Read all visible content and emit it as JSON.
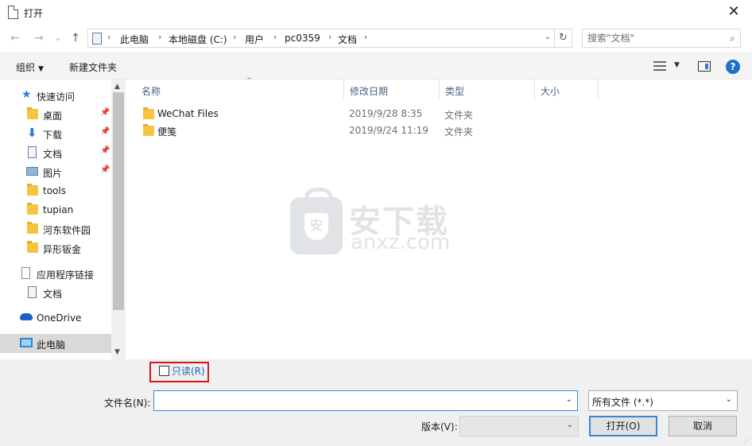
{
  "window": {
    "title": "打开",
    "close_glyph": "✕"
  },
  "nav": {
    "back_glyph": "←",
    "forward_glyph": "→",
    "recent_glyph": "⌄",
    "up_glyph": "↑",
    "breadcrumb": [
      "此电脑",
      "本地磁盘 (C:)",
      "用户",
      "pc0359",
      "文档"
    ],
    "sep": "›",
    "refresh_glyph": "↻",
    "search_placeholder": "搜索\"文档\"",
    "search_glyph": "⌕"
  },
  "toolbar": {
    "organize": "组织",
    "new_folder": "新建文件夹",
    "caret": "▼",
    "help": "?"
  },
  "sidebar": {
    "items": [
      {
        "label": "快速访问"
      },
      {
        "label": "桌面"
      },
      {
        "label": "下载"
      },
      {
        "label": "文档"
      },
      {
        "label": "图片"
      },
      {
        "label": "tools"
      },
      {
        "label": "tupian"
      },
      {
        "label": "河东软件园"
      },
      {
        "label": "异形钣金"
      },
      {
        "label": "应用程序链接"
      },
      {
        "label": "文档"
      },
      {
        "label": "OneDrive"
      },
      {
        "label": "此电脑"
      }
    ],
    "pin_glyph": "📌",
    "scroll_up": "▲",
    "scroll_down": "▼"
  },
  "files": {
    "columns": [
      "名称",
      "修改日期",
      "类型",
      "大小"
    ],
    "sort_glyph": "^",
    "rows": [
      {
        "name": "WeChat Files",
        "date": "2019/9/28 8:35",
        "type": "文件夹"
      },
      {
        "name": "便笺",
        "date": "2019/9/24 11:19",
        "type": "文件夹"
      }
    ]
  },
  "watermark": {
    "cn": "安下载",
    "en": "anxz.com",
    "shield": "安"
  },
  "bottom": {
    "readonly": "只读(R)",
    "filename_label": "文件名(N):",
    "filename_value": "",
    "filter": "所有文件 (*.*)",
    "version_label": "版本(V):",
    "open": "打开(O)",
    "cancel": "取消",
    "dd": "⌄"
  }
}
